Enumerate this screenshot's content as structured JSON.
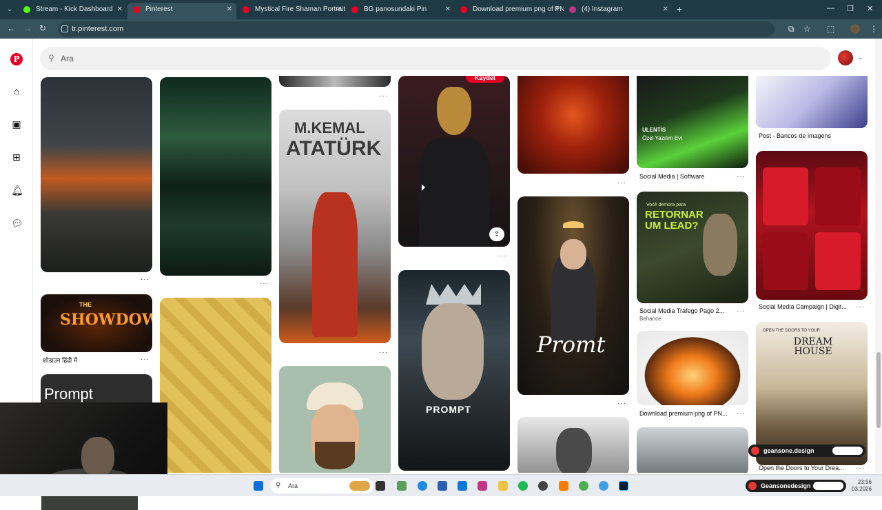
{
  "browser": {
    "tabs": [
      {
        "title": "Stream - Kick Dashboard",
        "active": false,
        "color": "#53fc18"
      },
      {
        "title": "Pinterest",
        "active": true,
        "color": "#e60023"
      },
      {
        "title": "Mystical Fire Shaman Portrait -",
        "active": false,
        "color": "#e60023"
      },
      {
        "title": "BG panosundaki Pin",
        "active": false,
        "color": "#e60023"
      },
      {
        "title": "Download premium png of PN",
        "active": false,
        "color": "#e60023"
      },
      {
        "title": "(4) Instagram",
        "active": false,
        "color": "#c13584"
      }
    ],
    "url": "tr.pinterest.com"
  },
  "pinterest": {
    "search": {
      "placeholder": "Ara"
    },
    "sidebar_icons": [
      "pinterest-logo-icon",
      "home-icon",
      "explore-icon",
      "create-icon",
      "notifications-icon",
      "messages-icon"
    ]
  },
  "pins": {
    "atatürk": {
      "line1": "M.KEMAL",
      "line2": "ATATÜRK"
    },
    "showdown": {
      "small": "THE",
      "big": "SHOWDOWN"
    },
    "prompt_card": "Prompt",
    "king": "PROMPT",
    "promt": "Promt",
    "retornar": {
      "small": "Você demora para",
      "big": "RETORNAR UM LEAD?"
    },
    "dream": {
      "small": "OPEN THE DOORS TO YOUR",
      "big": "DREAM HOUSE"
    },
    "deer_save": "Kaydet",
    "ulentis": {
      "line1": "ULENTIS",
      "line2": "Özel Yazılım Evi"
    }
  },
  "captions": {
    "post_bancos": "Post - Bancos de imagens",
    "social_software": "Social Media | Software",
    "showdown_hindi": "शोडाउन हिंदी में",
    "social_trafego": "Social Media Tráfego Pago 2...",
    "behance": "Behance",
    "social_campaign": "Social Media Campaign | Digit...",
    "download_png": "Download premium png of PN...",
    "dream_house": "Open the Doors to Your Drea..."
  },
  "overlay": {
    "ig_handle_1": "geansone.design",
    "ig_handle_2": "Geansonedesign"
  },
  "taskbar": {
    "search_placeholder": "Ara",
    "time": "23:56",
    "date": "03.2026"
  }
}
